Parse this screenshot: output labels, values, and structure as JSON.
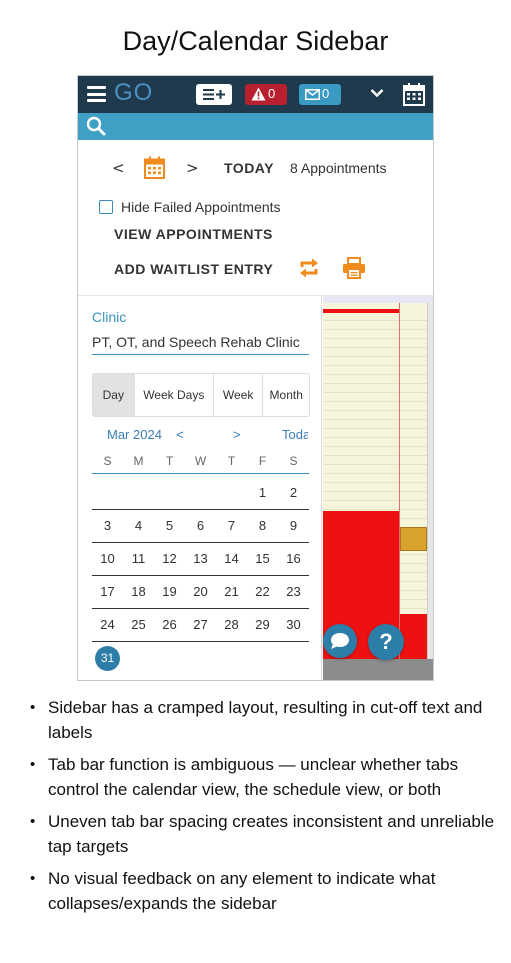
{
  "page_title": "Day/Calendar Sidebar",
  "app": {
    "logo": "GO",
    "alert_count": "0",
    "message_count": "0",
    "colors": {
      "topbar": "#1f3a4d",
      "searchbar": "#3ea0c4",
      "accent": "#3a92be",
      "alert": "#b8202f",
      "orange": "#f08c1e"
    }
  },
  "controls": {
    "prev": "<",
    "next": ">",
    "today": "TODAY",
    "appointments_count": "8 Appointments",
    "hide_failed": "Hide Failed Appointments",
    "view_appointments": "VIEW APPOINTMENTS",
    "add_waitlist": "ADD WAITLIST ENTRY"
  },
  "sidebar": {
    "clinic_label": "Clinic",
    "clinic_value": "PT, OT, and Speech Rehab Clinic",
    "tabs": [
      {
        "label": "Day",
        "active": true
      },
      {
        "label": "Week Days",
        "active": false
      },
      {
        "label": "Week",
        "active": false
      },
      {
        "label": "Month",
        "active": false
      }
    ],
    "calendar": {
      "month_label": "Mar 2024",
      "prev": "<",
      "next": ">",
      "today": "Today",
      "weekdays": [
        "S",
        "M",
        "T",
        "W",
        "T",
        "F",
        "S"
      ],
      "weeks": [
        [
          "",
          "",
          "",
          "",
          "",
          "1",
          "2"
        ],
        [
          "3",
          "4",
          "5",
          "6",
          "7",
          "8",
          "9"
        ],
        [
          "10",
          "11",
          "12",
          "13",
          "14",
          "15",
          "16"
        ],
        [
          "17",
          "18",
          "19",
          "20",
          "21",
          "22",
          "23"
        ],
        [
          "24",
          "25",
          "26",
          "27",
          "28",
          "29",
          "30"
        ],
        [
          "31",
          "",
          "",
          "",
          "",
          "",
          ""
        ]
      ],
      "selected_day": "31"
    }
  },
  "help": {
    "label": "?"
  },
  "notes": [
    "Sidebar has a cramped layout, resulting in cut-off text and labels",
    "Tab bar function is ambiguous — unclear whether tabs control the calendar view, the schedule view, or both",
    "Uneven tab bar spacing creates inconsistent and unreliable tap targets",
    "No visual feedback on any element to indicate what collapses/expands the sidebar"
  ]
}
